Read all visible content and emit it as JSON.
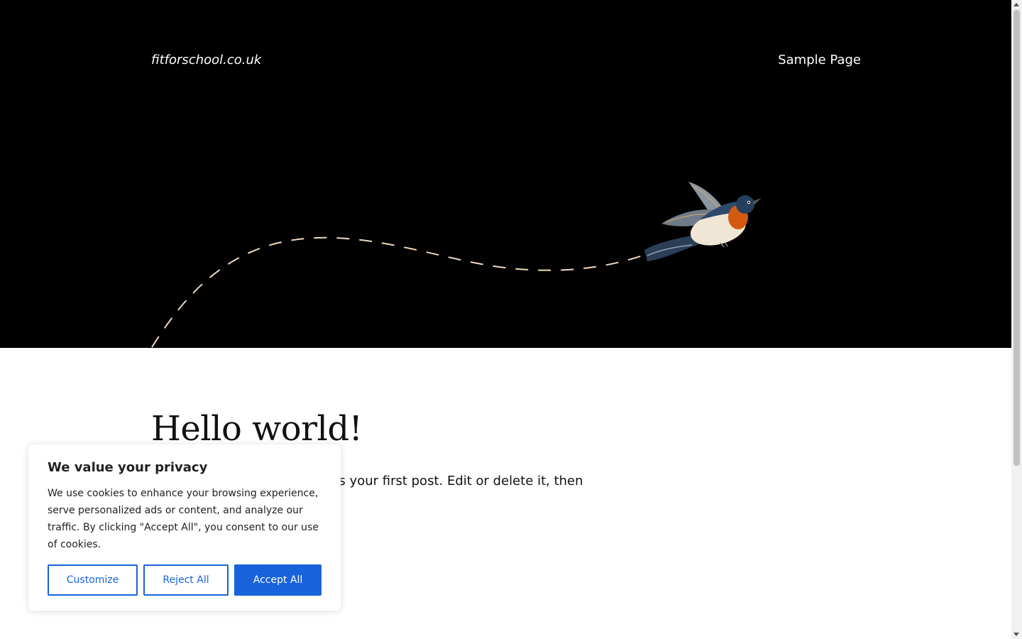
{
  "header": {
    "site_title": "fitforschool.co.uk",
    "nav": [
      {
        "label": "Sample Page"
      }
    ]
  },
  "post": {
    "title": "Hello world!",
    "excerpt": "Welcome to WordPress. This is your first post. Edit or delete it, then"
  },
  "cookie_banner": {
    "title": "We value your privacy",
    "text": "We use cookies to enhance your browsing experience, serve personalized ads or content, and analyze our traffic. By clicking \"Accept All\", you consent to our use of cookies.",
    "buttons": {
      "customize": "Customize",
      "reject": "Reject All",
      "accept": "Accept All"
    },
    "accent_color": "#1863dc"
  },
  "colors": {
    "hero_background": "#000000",
    "dashed_path": "#f0d9bf"
  }
}
